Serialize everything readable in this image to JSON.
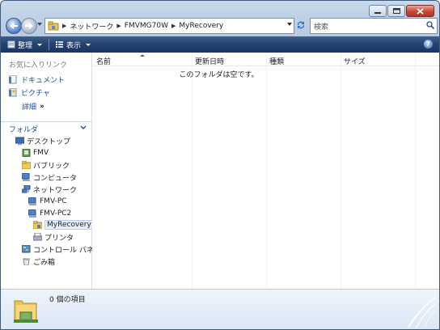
{
  "window": {
    "caption_buttons": [
      "minimize",
      "maximize",
      "close"
    ]
  },
  "address": {
    "crumbs": [
      "ネットワーク",
      "FMVMG70W",
      "MyRecovery"
    ]
  },
  "search": {
    "placeholder": "検索"
  },
  "toolbar": {
    "organize": "整理",
    "views": "表示"
  },
  "favorites": {
    "title": "お気に入りリンク",
    "items": [
      "ドキュメント",
      "ピクチャ"
    ],
    "details": "詳細"
  },
  "folders": {
    "title": "フォルダ",
    "tree": [
      {
        "label": "デスクトップ",
        "icon": "desktop-icon"
      },
      {
        "label": "FMV",
        "icon": "user-folder-icon"
      },
      {
        "label": "パブリック",
        "icon": "folder-icon"
      },
      {
        "label": "コンピュータ",
        "icon": "computer-icon"
      },
      {
        "label": "ネットワーク",
        "icon": "network-icon"
      },
      {
        "label": "FMV-PC",
        "icon": "computer-icon"
      },
      {
        "label": "FMV-PC2",
        "icon": "computer-icon"
      },
      {
        "label": "MyRecovery",
        "icon": "shared-folder-icon",
        "selected": true
      },
      {
        "label": "プリンタ",
        "icon": "printer-icon"
      },
      {
        "label": "コントロール パネル",
        "icon": "control-panel-icon"
      },
      {
        "label": "ごみ箱",
        "icon": "recycle-bin-icon"
      }
    ]
  },
  "columns": [
    "名前",
    "更新日時",
    "種類",
    "サイズ"
  ],
  "content": {
    "empty_message": "このフォルダは空です。"
  },
  "status": {
    "item_count": "0 個の項目"
  }
}
